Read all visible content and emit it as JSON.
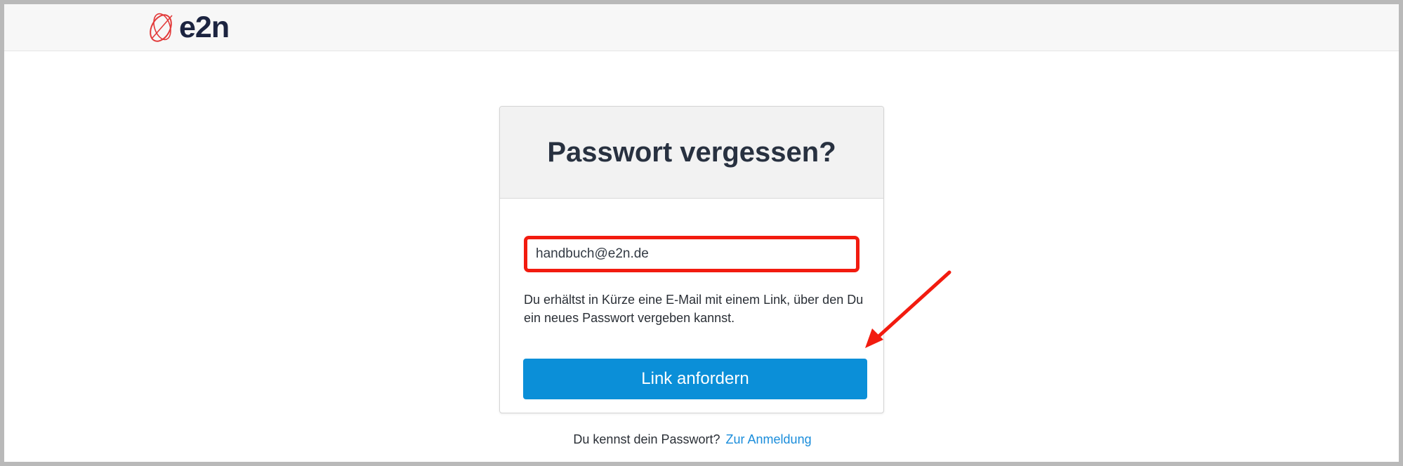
{
  "header": {
    "logo_text": "e2n",
    "logo_icon": "e2n-logo-mark",
    "background_color": "#f7f7f7"
  },
  "card": {
    "title": "Passwort vergessen?",
    "email": {
      "value": "handbuch@e2n.de",
      "placeholder": ""
    },
    "info_text": "Du erhältst in Kürze eine E-Mail mit einem Link, über den Du ein neues Passwort vergeben kannst.",
    "submit_label": "Link anfordern"
  },
  "footer": {
    "question": "Du kennst dein Passwort?",
    "login_link": "Zur Anmeldung"
  },
  "annotations": {
    "highlight_color": "#f21b0f",
    "arrow_icon": "red-arrow-icon"
  },
  "colors": {
    "brand_dark": "#1c2440",
    "brand_red": "#e23a3a",
    "button_blue": "#0b8fd8",
    "link_blue": "#1a8ddb"
  }
}
